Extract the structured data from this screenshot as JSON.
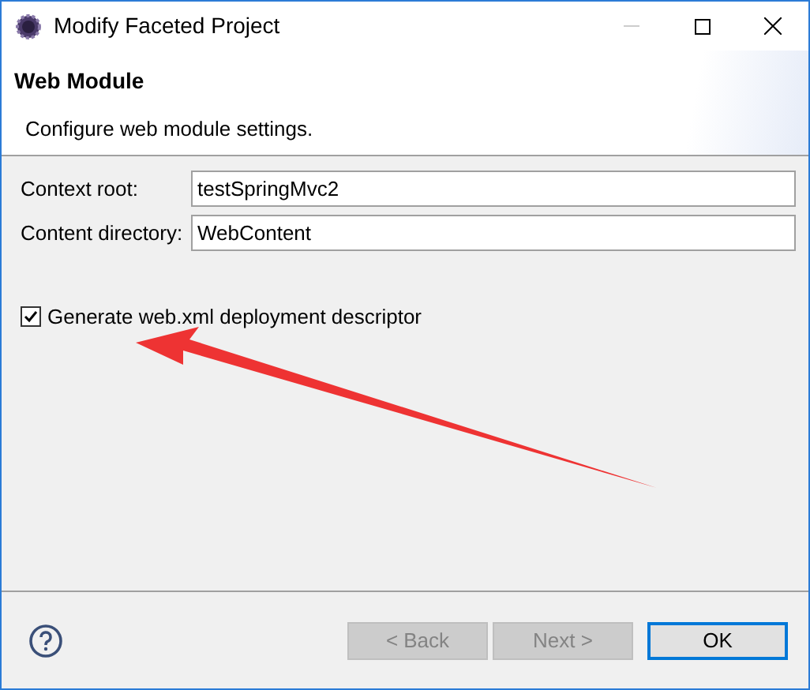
{
  "window": {
    "title": "Modify Faceted Project",
    "minimize_disabled": true
  },
  "header": {
    "title": "Web Module",
    "description": "Configure web module settings."
  },
  "fields": [
    {
      "label": "Context root:",
      "value": "testSpringMvc2"
    },
    {
      "label": "Content directory:",
      "value": "WebContent"
    }
  ],
  "checkbox": {
    "label": "Generate web.xml deployment descriptor",
    "checked": true
  },
  "buttons": [
    {
      "label": "< Back",
      "disabled": true,
      "default": false
    },
    {
      "label": "Next >",
      "disabled": true,
      "default": false
    },
    {
      "label": "OK",
      "disabled": false,
      "default": true
    }
  ]
}
